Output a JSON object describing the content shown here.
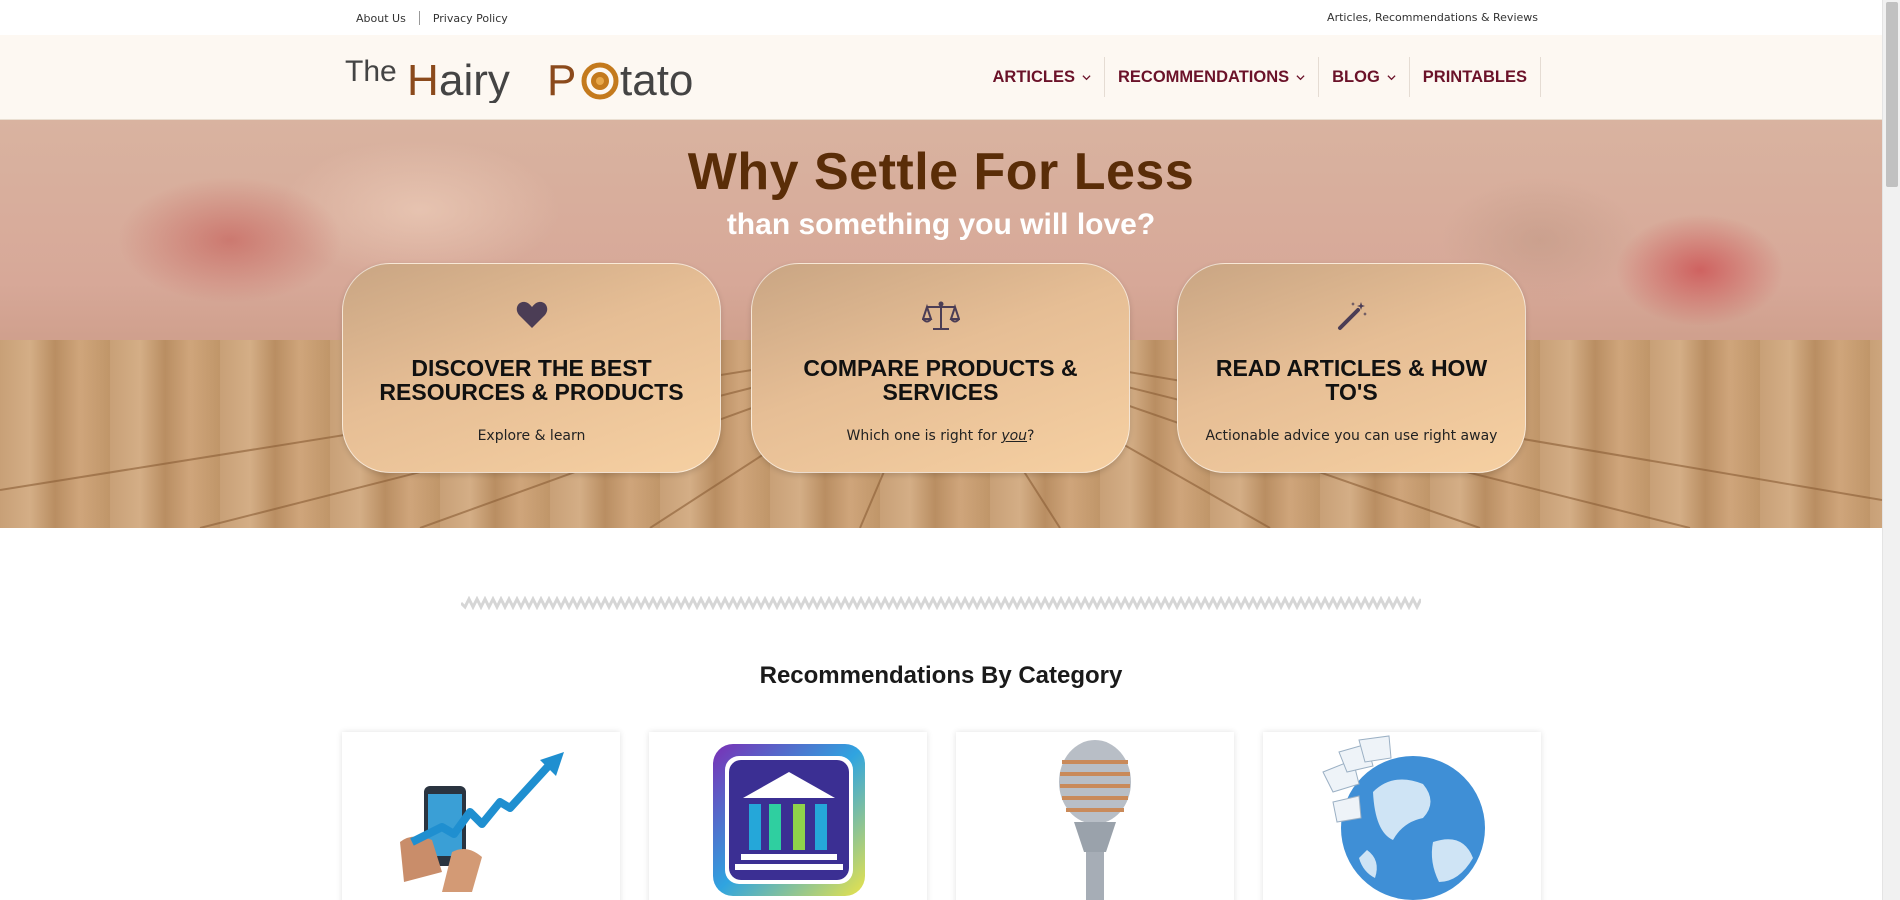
{
  "topbar": {
    "links": [
      "About Us",
      "Privacy Policy"
    ],
    "tagline": "Articles, Recommendations & Reviews"
  },
  "header": {
    "logo_text": "The Hairy Potato",
    "nav": [
      {
        "label": "ARTICLES",
        "has_dropdown": true
      },
      {
        "label": "RECOMMENDATIONS",
        "has_dropdown": true
      },
      {
        "label": "BLOG",
        "has_dropdown": true
      },
      {
        "label": "PRINTABLES",
        "has_dropdown": false
      }
    ]
  },
  "hero": {
    "title": "Why Settle For Less",
    "subtitle": "than something you will love?",
    "cards": [
      {
        "icon": "heart-icon",
        "title": "DISCOVER THE BEST RESOURCES & PRODUCTS",
        "desc": "Explore & learn"
      },
      {
        "icon": "scales-icon",
        "title": "COMPARE PRODUCTS & SERVICES",
        "desc_prefix": "Which one is right for ",
        "desc_emph": "you",
        "desc_suffix": "?"
      },
      {
        "icon": "magic-wand-icon",
        "title": "READ ARTICLES & HOW TO'S",
        "desc": "Actionable advice you can use right away"
      }
    ]
  },
  "recommendations": {
    "title": "Recommendations By Category",
    "categories": [
      {
        "icon": "phone-growth-chart-image"
      },
      {
        "icon": "bank-building-image"
      },
      {
        "icon": "microphone-image"
      },
      {
        "icon": "globe-image"
      }
    ]
  },
  "colors": {
    "nav_text": "#6b1229",
    "hero_title": "#5a2d08",
    "header_bg": "#fdf8f2"
  }
}
